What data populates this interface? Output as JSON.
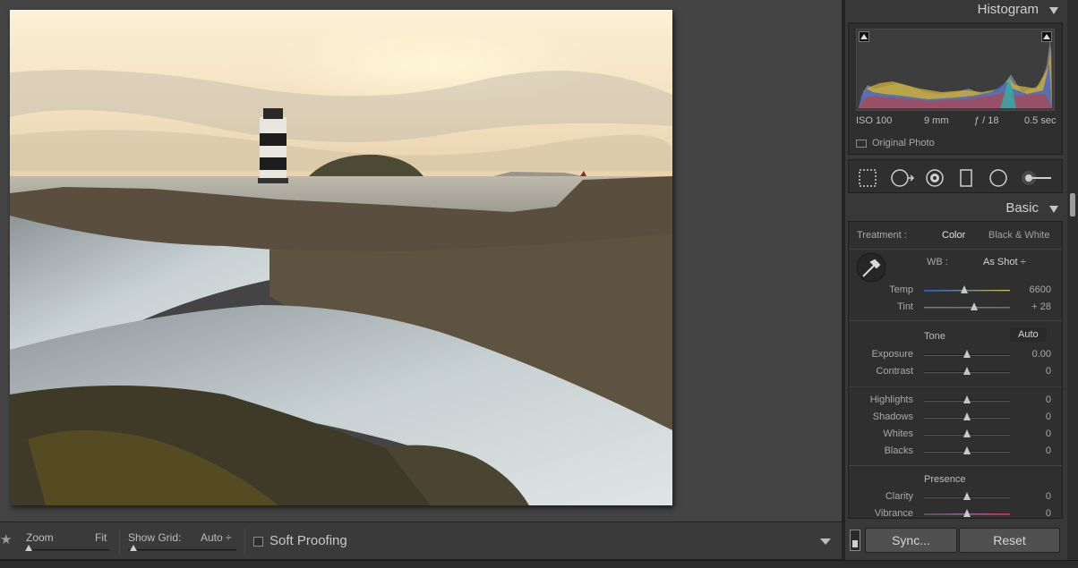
{
  "panels": {
    "histogram_title": "Histogram",
    "basic_title": "Basic"
  },
  "histogram": {
    "iso": "ISO 100",
    "focal": "9 mm",
    "aperture": "ƒ / 18",
    "shutter": "0.5 sec",
    "original_photo": "Original Photo"
  },
  "basic": {
    "treatment_label": "Treatment :",
    "treatment_color": "Color",
    "treatment_bw": "Black & White",
    "wb_label": "WB :",
    "wb_value": "As Shot ÷",
    "temp": {
      "label": "Temp",
      "value": "6600",
      "pos": 0.47
    },
    "tint": {
      "label": "Tint",
      "value": "+ 28",
      "pos": 0.58
    },
    "tone_label": "Tone",
    "auto_label": "Auto",
    "exposure": {
      "label": "Exposure",
      "value": "0.00",
      "pos": 0.5
    },
    "contrast": {
      "label": "Contrast",
      "value": "0",
      "pos": 0.5
    },
    "highlights": {
      "label": "Highlights",
      "value": "0",
      "pos": 0.5
    },
    "shadows": {
      "label": "Shadows",
      "value": "0",
      "pos": 0.5
    },
    "whites": {
      "label": "Whites",
      "value": "0",
      "pos": 0.5
    },
    "blacks": {
      "label": "Blacks",
      "value": "0",
      "pos": 0.5
    },
    "presence_label": "Presence",
    "clarity": {
      "label": "Clarity",
      "value": "0",
      "pos": 0.5
    },
    "vibrance": {
      "label": "Vibrance",
      "value": "0",
      "pos": 0.5
    }
  },
  "toolbar": {
    "zoom_label": "Zoom",
    "zoom_value": "Fit",
    "grid_label": "Show Grid:",
    "grid_value": "Auto ÷",
    "soft_proofing": "Soft Proofing"
  },
  "buttons": {
    "sync": "Sync...",
    "reset": "Reset"
  }
}
